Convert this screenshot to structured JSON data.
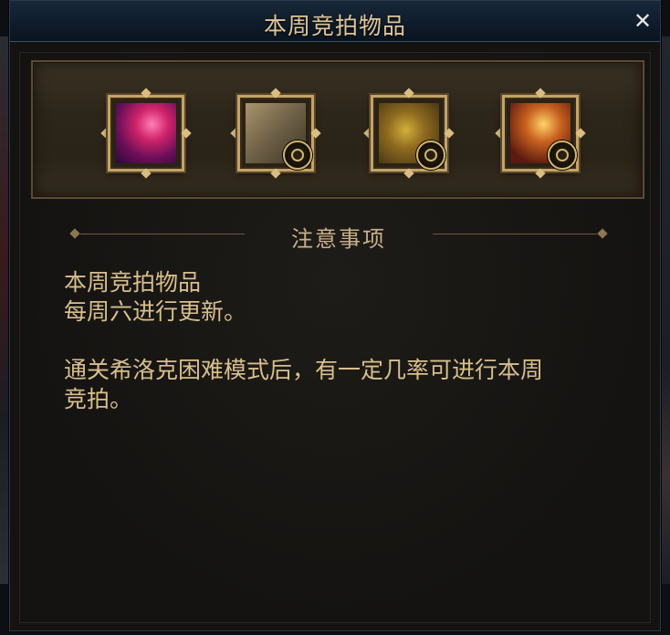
{
  "window": {
    "title": "本周竞拍物品",
    "close_glyph": "✕"
  },
  "items": [
    {
      "name": "pink-weapon-item-icon",
      "has_badge": false
    },
    {
      "name": "scroll-item-icon",
      "has_badge": true
    },
    {
      "name": "gear-item-icon",
      "has_badge": true
    },
    {
      "name": "fire-item-icon",
      "has_badge": true
    }
  ],
  "notice": {
    "heading": "注意事项",
    "line1": "本周竞拍物品",
    "line2": "每周六进行更新。",
    "line3": "通关希洛克困难模式后，有一定几率可进行本周",
    "line4": "竞拍。"
  },
  "colors": {
    "title": "#dfc79a",
    "text": "#d9bf8d",
    "frame_gold": "#c2a46a",
    "titlebar": "#17283a"
  }
}
